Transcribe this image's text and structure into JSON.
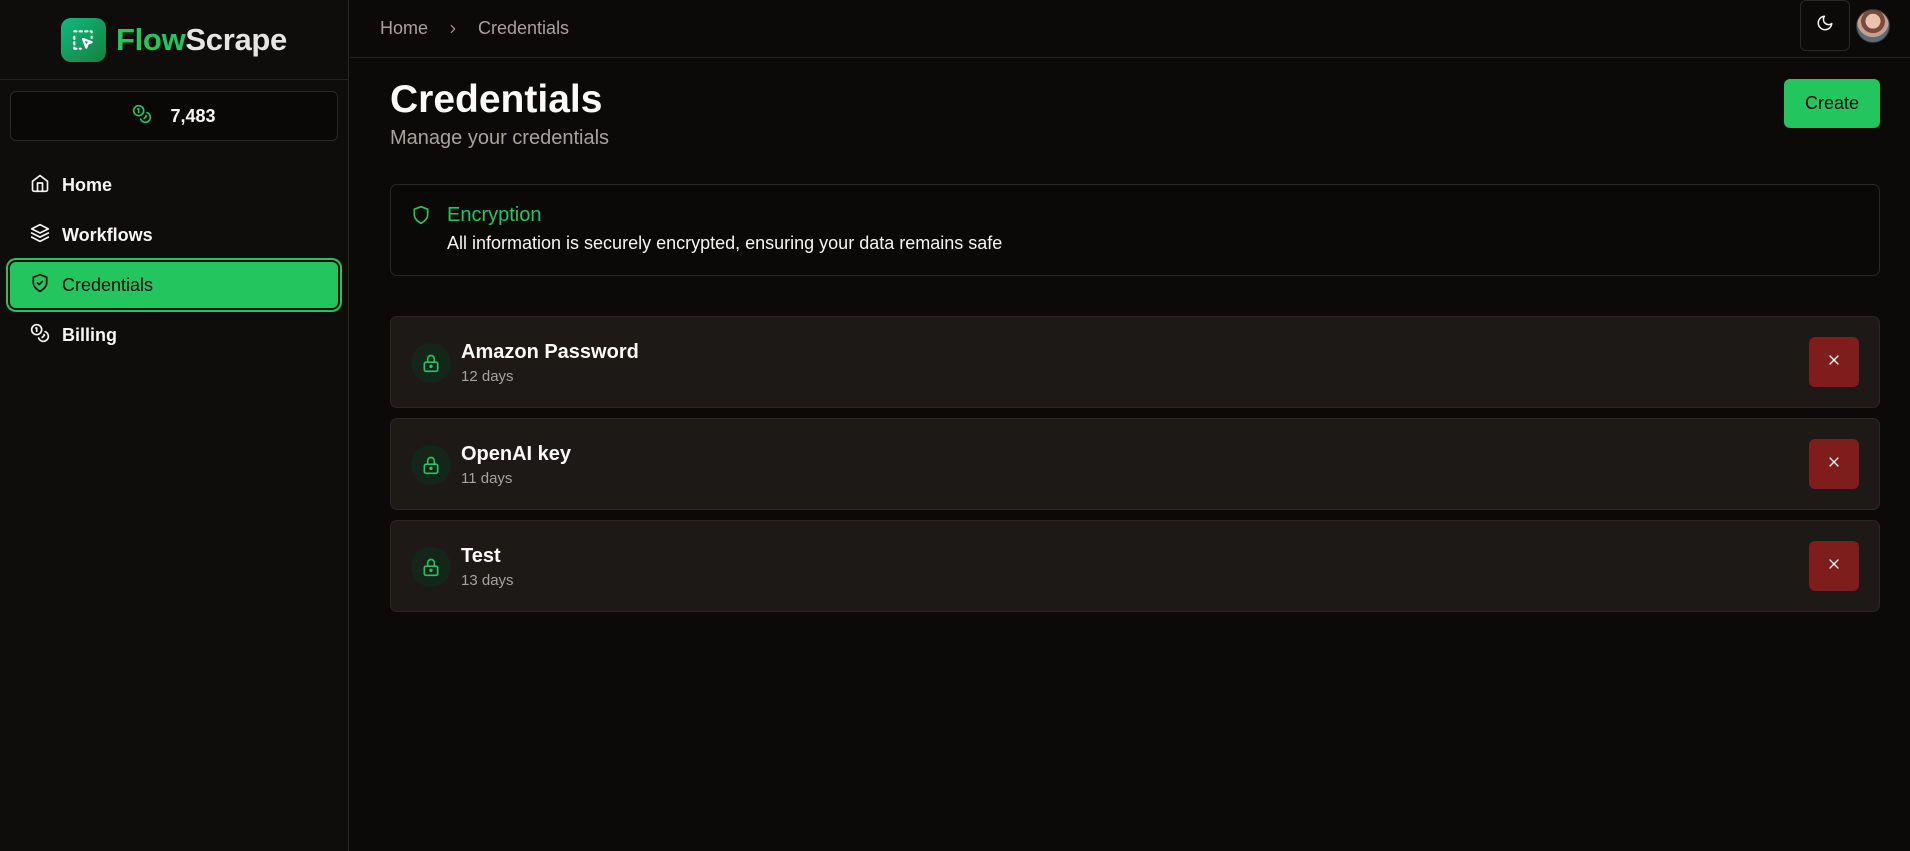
{
  "app": {
    "logo_part1": "Flow",
    "logo_part2": "Scrape",
    "accent_color": "#22c55e",
    "danger_color": "#7f1d1d"
  },
  "credits": {
    "icon": "coins-icon",
    "value": "7,483"
  },
  "sidebar": {
    "items": [
      {
        "label": "Home",
        "icon": "home-icon",
        "active": false
      },
      {
        "label": "Workflows",
        "icon": "layers-icon",
        "active": false
      },
      {
        "label": "Credentials",
        "icon": "shield-icon",
        "active": true
      },
      {
        "label": "Billing",
        "icon": "coins-icon",
        "active": false
      }
    ]
  },
  "breadcrumb": {
    "items": [
      "Home",
      "Credentials"
    ]
  },
  "header": {
    "title": "Credentials",
    "subtitle": "Manage your credentials",
    "create_label": "Create"
  },
  "alert": {
    "icon": "shield-icon",
    "title": "Encryption",
    "description": "All information is securely encrypted, ensuring your data remains safe"
  },
  "credentials": [
    {
      "name": "Amazon Password",
      "age": "12 days",
      "icon": "lock-icon"
    },
    {
      "name": "OpenAI key",
      "age": "11 days",
      "icon": "lock-icon"
    },
    {
      "name": "Test",
      "age": "13 days",
      "icon": "lock-icon"
    }
  ]
}
